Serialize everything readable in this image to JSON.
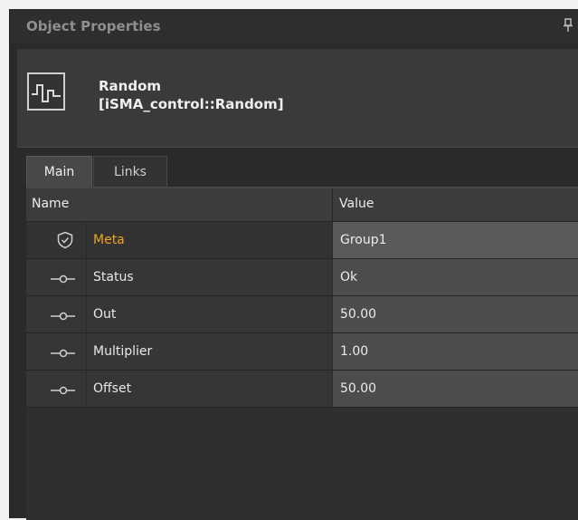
{
  "panel": {
    "title": "Object Properties",
    "pin_icon": "pin-icon"
  },
  "object": {
    "name": "Random",
    "type": "[iSMA_control::Random]",
    "icon": "random-block-icon"
  },
  "tabs": [
    {
      "label": "Main",
      "active": true
    },
    {
      "label": "Links",
      "active": false
    }
  ],
  "grid": {
    "columns": {
      "name": "Name",
      "value": "Value"
    },
    "rows": [
      {
        "name": "Meta",
        "value": "Group1",
        "icon": "shield-check-icon",
        "selected": true
      },
      {
        "name": "Status",
        "value": "Ok",
        "icon": "slot-icon"
      },
      {
        "name": "Out",
        "value": "50.00",
        "icon": "slot-icon"
      },
      {
        "name": "Multiplier",
        "value": "1.00",
        "icon": "slot-icon"
      },
      {
        "name": "Offset",
        "value": "50.00",
        "icon": "slot-icon"
      }
    ]
  },
  "colors": {
    "panel_bg": "#2a2a2a",
    "meta_accent": "#f0a51c",
    "value_bg": "#4c4c4c"
  }
}
